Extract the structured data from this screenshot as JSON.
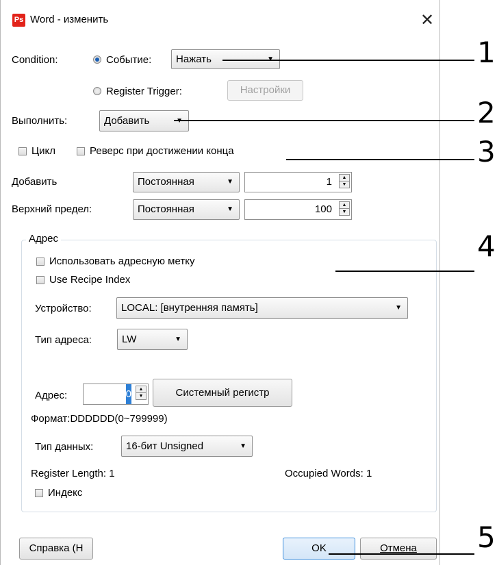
{
  "window": {
    "app_icon_text": "Ps",
    "title": "Word - изменить",
    "close_glyph": "✕"
  },
  "condition": {
    "label": "Condition:",
    "event_radio_label": "Событие:",
    "event_value": "Нажать",
    "register_trigger_label": "Register Trigger:",
    "settings_button": "Настройки"
  },
  "execute": {
    "label": "Выполнить:",
    "value": "Добавить"
  },
  "options": {
    "cycle_label": "Цикл",
    "reverse_label": "Реверс при достижении конца"
  },
  "add_row": {
    "label": "Добавить",
    "type_value": "Постоянная",
    "number": "1"
  },
  "upper_row": {
    "label": "Верхний предел:",
    "type_value": "Постоянная",
    "number": "100"
  },
  "address_group": {
    "title": "Адрес",
    "use_tag_label": "Использовать адресную метку",
    "recipe_index_label": "Use Recipe Index",
    "device_label": "Устройство:",
    "device_value": "LOCAL: [внутренняя память]",
    "addr_type_label": "Тип адреса:",
    "addr_type_value": "LW",
    "address_label": "Адрес:",
    "address_value": "0",
    "system_register_button": "Системный регистр",
    "format_text": "Формат:DDDDDD(0~799999)",
    "data_type_label": "Тип данных:",
    "data_type_value": "16-бит Unsigned",
    "register_length": "Register Length: 1",
    "occupied_words": "Occupied Words: 1",
    "index_label": "Индекс"
  },
  "footer": {
    "help_button": "Справка (H",
    "ok_button": "OK",
    "cancel_button": "Отмена"
  },
  "callouts": [
    "1",
    "2",
    "3",
    "4",
    "5"
  ],
  "icons": {
    "dropdown": "▼",
    "spin_up": "▲",
    "spin_down": "▼"
  },
  "colors": {
    "accent": "#1a5fb4",
    "app_icon": "#e2231a",
    "default_button_border": "#3c8ddc"
  }
}
